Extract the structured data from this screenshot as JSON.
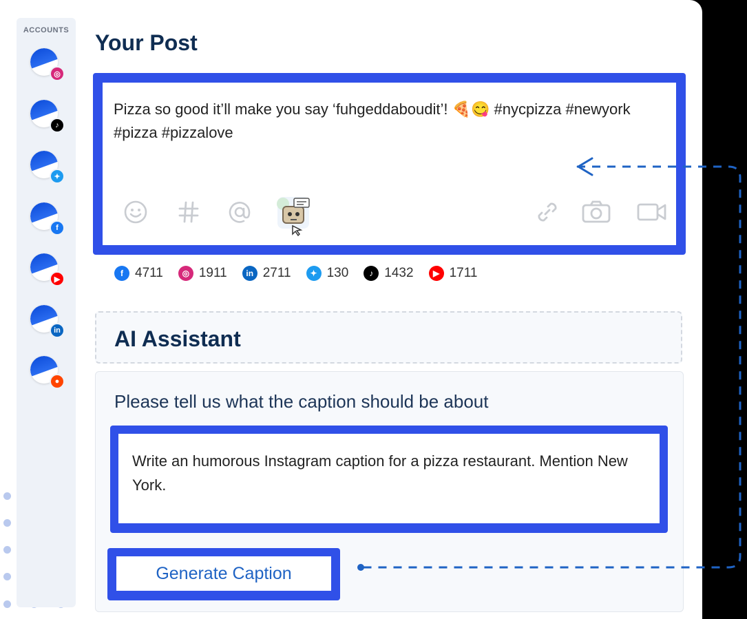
{
  "sidebar": {
    "title": "ACCOUNTS",
    "accounts": [
      {
        "network": "instagram",
        "badge_color": "#d6297a",
        "icon": "instagram-icon"
      },
      {
        "network": "tiktok",
        "badge_color": "#000000",
        "icon": "tiktok-icon"
      },
      {
        "network": "twitter",
        "badge_color": "#1d9bf0",
        "icon": "twitter-icon"
      },
      {
        "network": "facebook",
        "badge_color": "#1877f2",
        "icon": "facebook-icon"
      },
      {
        "network": "youtube",
        "badge_color": "#ff0000",
        "icon": "youtube-icon"
      },
      {
        "network": "linkedin",
        "badge_color": "#0a66c2",
        "icon": "linkedin-icon"
      },
      {
        "network": "reddit",
        "badge_color": "#ff4500",
        "icon": "reddit-icon"
      }
    ]
  },
  "post": {
    "title": "Your Post",
    "text": "Pizza so good it’ll make you say ‘fuhgeddaboudit’! 🍕😋 #nycpizza #newyork #pizza #pizzalove",
    "toolbar_left": [
      "emoji-icon",
      "hashtag-icon",
      "mention-icon",
      "ai-robot-icon"
    ],
    "toolbar_right": [
      "link-icon",
      "camera-icon",
      "video-icon"
    ]
  },
  "counts": [
    {
      "network": "facebook",
      "value": "4711",
      "color": "#1877f2"
    },
    {
      "network": "instagram",
      "value": "1911",
      "color": "#d6297a"
    },
    {
      "network": "linkedin",
      "value": "2711",
      "color": "#0a66c2"
    },
    {
      "network": "twitter",
      "value": "130",
      "color": "#1d9bf0"
    },
    {
      "network": "tiktok",
      "value": "1432",
      "color": "#000000"
    },
    {
      "network": "youtube",
      "value": "1711",
      "color": "#ff0000"
    }
  ],
  "ai": {
    "title": "AI Assistant",
    "prompt_label": "Please tell us what the caption should be about",
    "prompt_value": "Write an humorous Instagram caption for a pizza restaurant. Mention New York.",
    "generate_label": "Generate Caption"
  },
  "colors": {
    "accent": "#3050e8",
    "heading": "#0f2d52",
    "button_text": "#1f63c4"
  }
}
